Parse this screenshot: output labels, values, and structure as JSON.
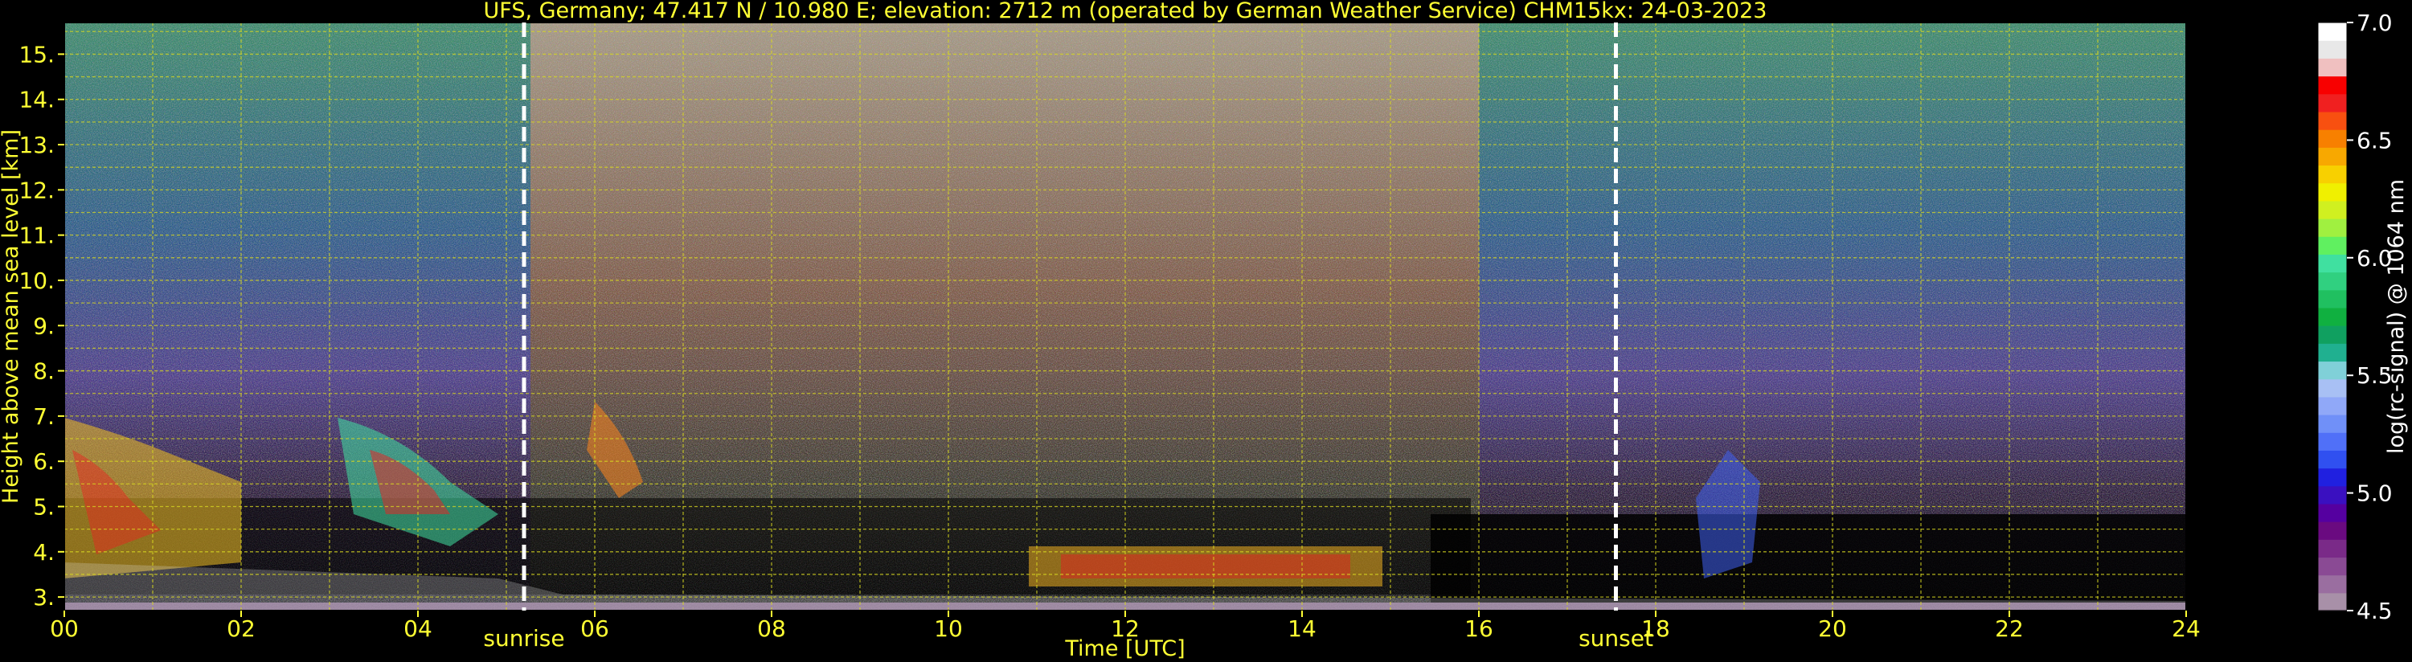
{
  "chart_data": {
    "type": "heatmap",
    "title": "UFS, Germany; 47.417 N / 10.980 E; elevation: 2712 m  (operated by German Weather Service)     CHM15kx: 24-03-2023",
    "xlabel": "Time [UTC]",
    "ylabel": "Height above mean sea level [km]",
    "xlim": [
      0,
      24
    ],
    "ylim": [
      2.7,
      15.7
    ],
    "x_ticks": [
      "00",
      "02",
      "04",
      "06",
      "08",
      "10",
      "12",
      "14",
      "16",
      "18",
      "20",
      "22",
      "24"
    ],
    "x_tick_values": [
      0,
      2,
      4,
      6,
      8,
      10,
      12,
      14,
      16,
      18,
      20,
      22,
      24
    ],
    "y_ticks": [
      "3.",
      "4.",
      "5.",
      "6.",
      "7.",
      "8.",
      "9.",
      "10.",
      "11.",
      "12.",
      "13.",
      "14.",
      "15."
    ],
    "y_tick_values": [
      3,
      4,
      5,
      6,
      7,
      8,
      9,
      10,
      11,
      12,
      13,
      14,
      15
    ],
    "grid": true,
    "colorbar": {
      "label": "log(rc-signal) @ 1064 nm",
      "range": [
        4.5,
        7.0
      ],
      "ticks": [
        "4.5",
        "5.0",
        "5.5",
        "6.0",
        "6.5",
        "7.0"
      ],
      "tick_values": [
        4.5,
        5.0,
        5.5,
        6.0,
        6.5,
        7.0
      ],
      "colors": [
        "#a890a8",
        "#9a6ea0",
        "#8a4a94",
        "#7a2a88",
        "#6a0a80",
        "#5500a0",
        "#3a10c0",
        "#2020e0",
        "#3050f0",
        "#5070f8",
        "#7090f8",
        "#90a8f8",
        "#a8c0f4",
        "#80d0d8",
        "#20b090",
        "#10a060",
        "#10b040",
        "#20c060",
        "#30d080",
        "#40e0a0",
        "#60f060",
        "#a0f040",
        "#d0f020",
        "#f0f000",
        "#f8d000",
        "#f8a800",
        "#f88000",
        "#f85010",
        "#f02020",
        "#f80000",
        "#f0c0c0",
        "#e8e8e8",
        "#ffffff"
      ]
    },
    "annotations": [
      {
        "text": "sunrise",
        "x": 5.2
      },
      {
        "text": "sunset",
        "x": 17.55
      }
    ],
    "reference_lines": [
      5.2,
      17.55
    ]
  }
}
